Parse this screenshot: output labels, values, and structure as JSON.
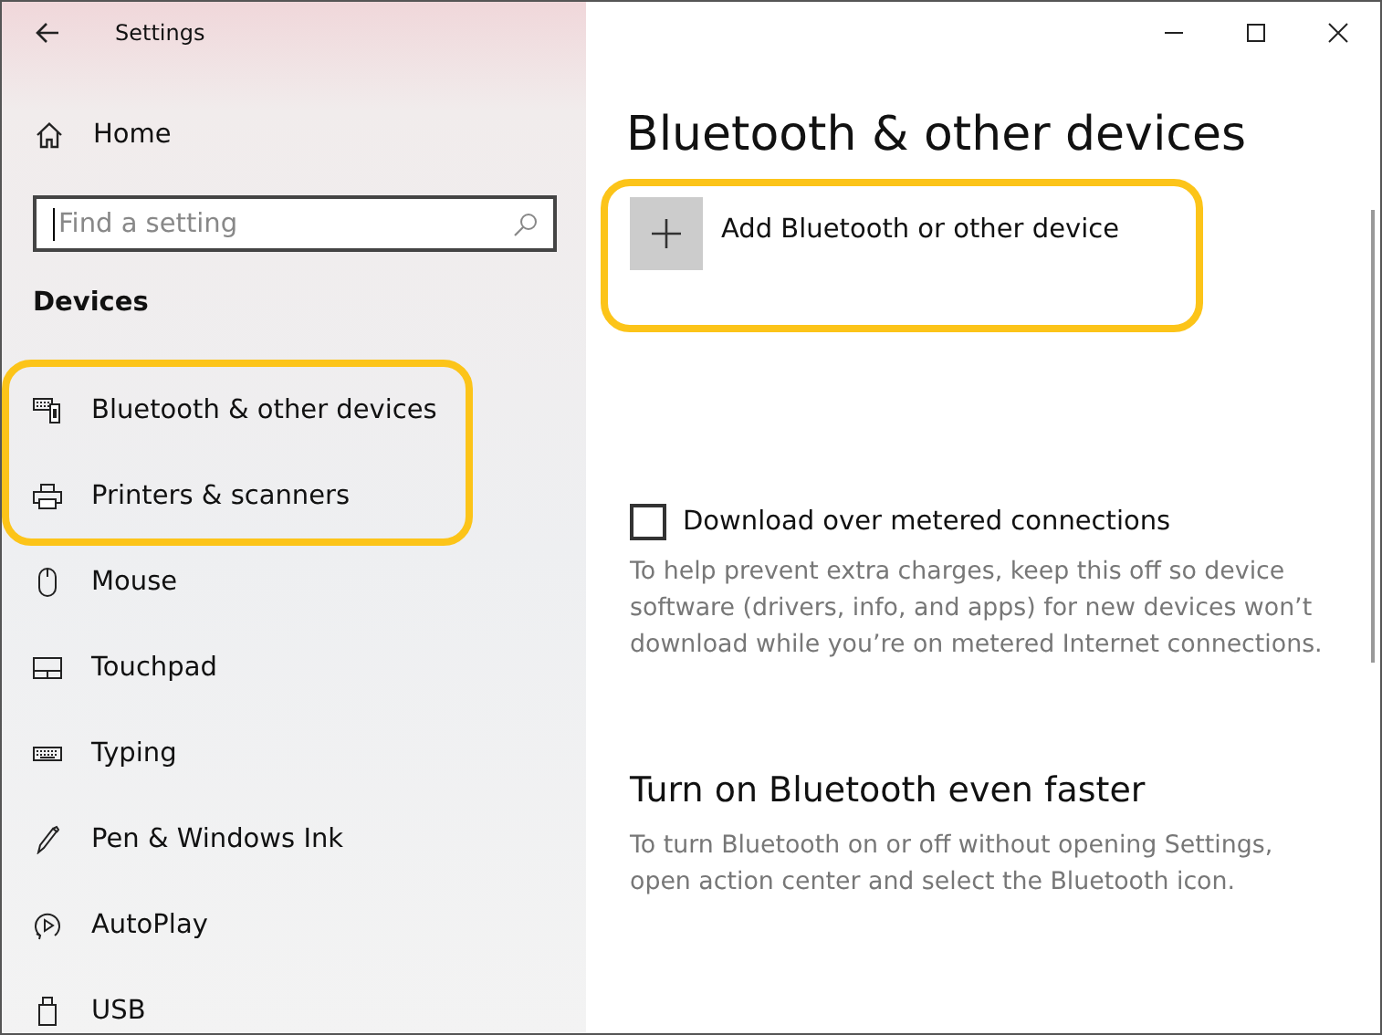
{
  "window": {
    "title": "Settings"
  },
  "sidebar": {
    "home": "Home",
    "search": {
      "placeholder": "Find a setting"
    },
    "section": "Devices",
    "items": [
      {
        "kind": "bluetooth",
        "label": "Bluetooth & other devices",
        "highlighted": true
      },
      {
        "kind": "printer",
        "label": "Printers & scanners",
        "highlighted": true
      },
      {
        "kind": "mouse",
        "label": "Mouse",
        "highlighted": false
      },
      {
        "kind": "touchpad",
        "label": "Touchpad",
        "highlighted": false
      },
      {
        "kind": "typing",
        "label": "Typing",
        "highlighted": false
      },
      {
        "kind": "pen",
        "label": "Pen & Windows Ink",
        "highlighted": false
      },
      {
        "kind": "autoplay",
        "label": "AutoPlay",
        "highlighted": false
      },
      {
        "kind": "usb",
        "label": "USB",
        "highlighted": false
      }
    ]
  },
  "content": {
    "title": "Bluetooth & other devices",
    "add_device": {
      "label": "Add Bluetooth or other device",
      "highlighted": true
    },
    "metered": {
      "label": "Download over metered connections",
      "checked": false,
      "description": "To help prevent extra charges, keep this off so device software (drivers, info, and apps) for new devices won’t download while you’re on metered Internet connections."
    },
    "faster": {
      "heading": "Turn on Bluetooth even faster",
      "description": "To turn Bluetooth on or off without opening Settings, open action center and select the Bluetooth icon."
    }
  }
}
